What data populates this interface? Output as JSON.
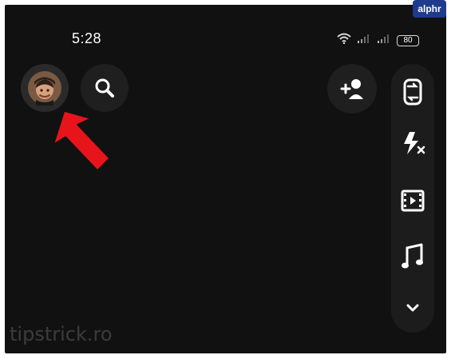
{
  "watermark": {
    "brand": "alphr",
    "site": "tipstrick.ro"
  },
  "status_bar": {
    "time": "5:28",
    "battery": "80",
    "icons": [
      "wifi-icon",
      "signal-icon",
      "signal-icon"
    ]
  },
  "top_bar": {
    "left": [
      "avatar",
      "search-icon"
    ],
    "right": [
      "add-friend-icon"
    ]
  },
  "camera_tools": {
    "items": [
      "flip-camera-icon",
      "flash-off-icon",
      "video-icon",
      "music-icon",
      "chevron-down-icon"
    ]
  },
  "annotation": {
    "arrow_color": "#e8141b"
  }
}
